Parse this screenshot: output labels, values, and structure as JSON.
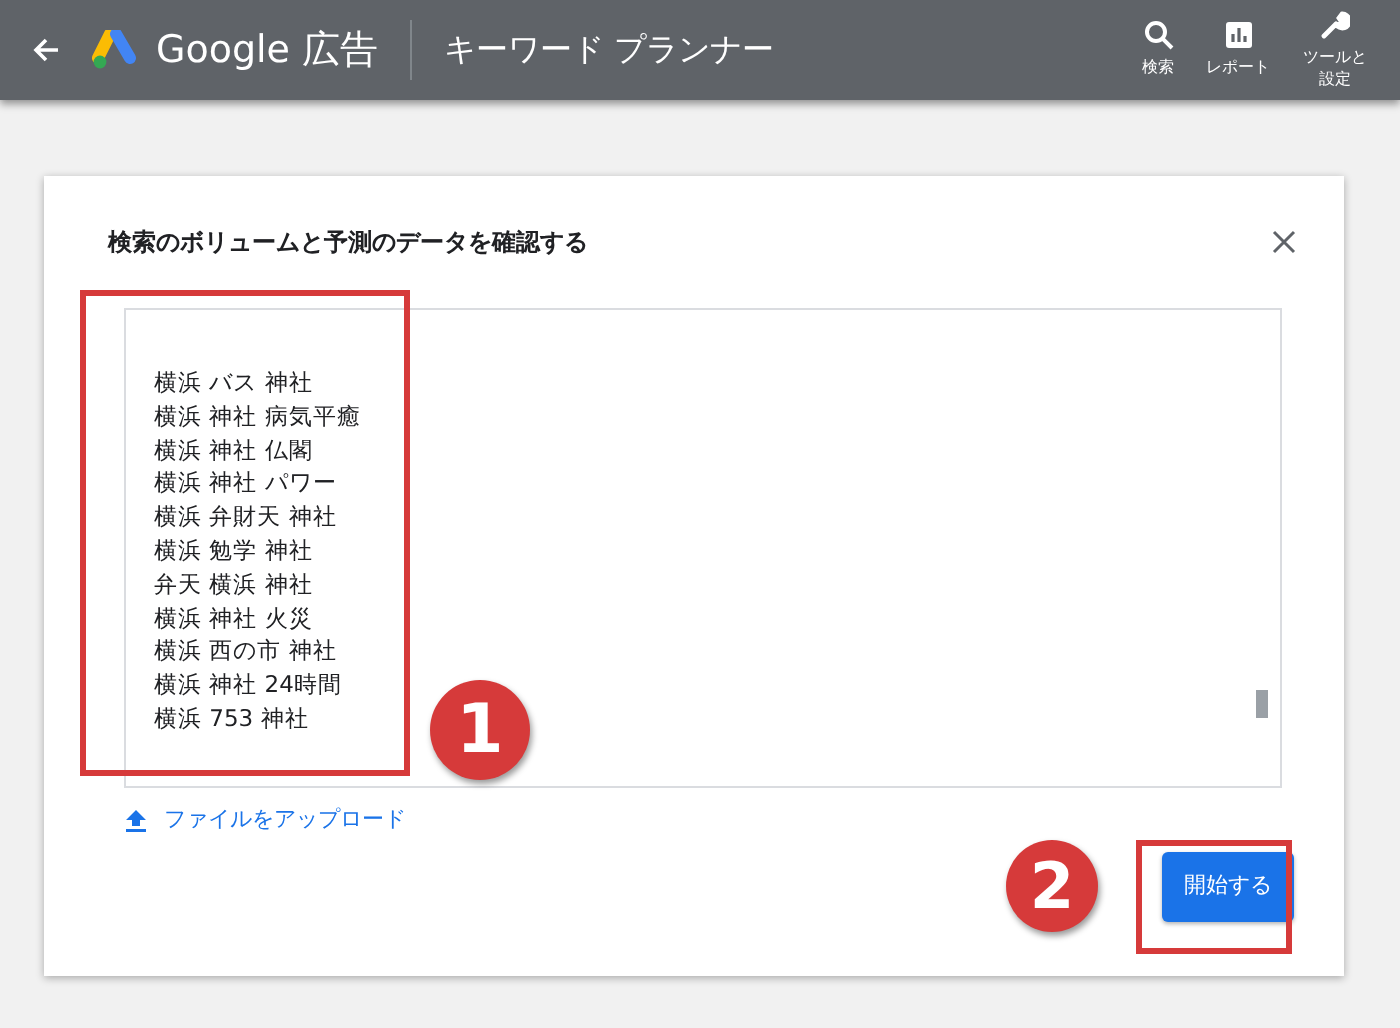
{
  "top_bar": {
    "product": "Google 広告",
    "page_title": "キーワード プランナー",
    "actions": [
      {
        "kind": "search",
        "label": "検索"
      },
      {
        "kind": "report",
        "label": "レポート"
      },
      {
        "kind": "tools",
        "label": "ツールと設定"
      }
    ]
  },
  "dialog": {
    "title": "検索のボリュームと予測のデータを確認する",
    "keywords": [
      "横浜 バス 神社",
      "横浜 神社 病気平癒",
      "横浜 神社 仏閣",
      "横浜 神社 パワー",
      "横浜 弁財天 神社",
      "横浜 勉学 神社",
      "弁天 横浜 神社",
      "横浜 神社 火災",
      "横浜 西の市 神社",
      "横浜 神社 24時間",
      "横浜 753 神社"
    ],
    "upload_link": "ファイルをアップロード",
    "start_button": "開始する"
  },
  "annotations": [
    {
      "number": "1"
    },
    {
      "number": "2"
    }
  ]
}
